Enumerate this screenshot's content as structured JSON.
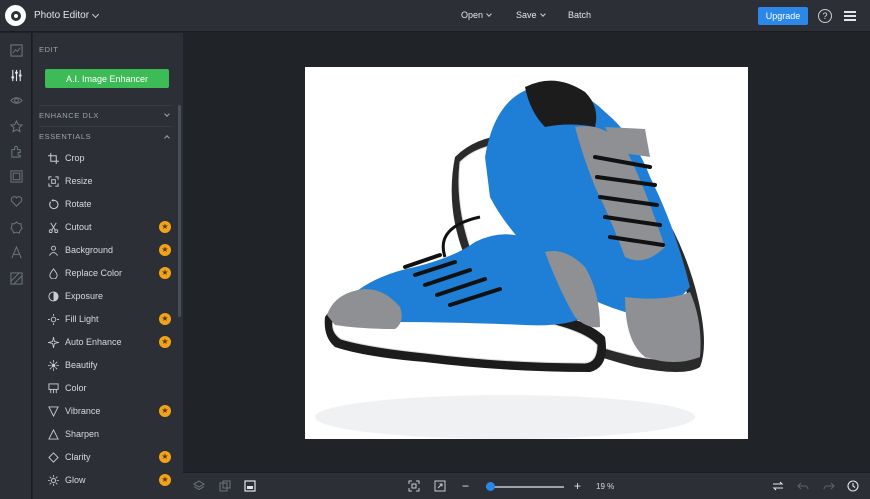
{
  "header": {
    "app_title": "Photo Editor",
    "menu": [
      {
        "label": "Open",
        "has_dropdown": true
      },
      {
        "label": "Save",
        "has_dropdown": true
      },
      {
        "label": "Batch",
        "has_dropdown": false
      }
    ],
    "upgrade_label": "Upgrade",
    "help_label": "?"
  },
  "rail": {
    "icons": [
      "image-icon",
      "sliders-icon",
      "eye-icon",
      "star-icon",
      "puzzle-icon",
      "frame-icon",
      "heart-icon",
      "badge-icon",
      "text-icon",
      "texture-icon"
    ],
    "active": "sliders-icon"
  },
  "panel": {
    "title": "EDIT",
    "ai_button": "A.I. Image Enhancer",
    "sections": [
      {
        "label": "ENHANCE DLX",
        "expanded": false
      },
      {
        "label": "ESSENTIALS",
        "expanded": true
      }
    ],
    "tools": [
      {
        "label": "Crop",
        "icon": "crop-icon",
        "premium": false
      },
      {
        "label": "Resize",
        "icon": "resize-icon",
        "premium": false
      },
      {
        "label": "Rotate",
        "icon": "rotate-icon",
        "premium": false
      },
      {
        "label": "Cutout",
        "icon": "scissors-icon",
        "premium": true
      },
      {
        "label": "Background",
        "icon": "background-icon",
        "premium": true
      },
      {
        "label": "Replace Color",
        "icon": "droplet-icon",
        "premium": true
      },
      {
        "label": "Exposure",
        "icon": "exposure-icon",
        "premium": false
      },
      {
        "label": "Fill Light",
        "icon": "fill-light-icon",
        "premium": true
      },
      {
        "label": "Auto Enhance",
        "icon": "sparkle-icon",
        "premium": true
      },
      {
        "label": "Beautify",
        "icon": "beautify-icon",
        "premium": false
      },
      {
        "label": "Color",
        "icon": "color-icon",
        "premium": false
      },
      {
        "label": "Vibrance",
        "icon": "vibrance-icon",
        "premium": true
      },
      {
        "label": "Sharpen",
        "icon": "sharpen-icon",
        "premium": false
      },
      {
        "label": "Clarity",
        "icon": "clarity-icon",
        "premium": true
      },
      {
        "label": "Glow",
        "icon": "glow-icon",
        "premium": true
      }
    ]
  },
  "bottombar": {
    "zoom_level": 19,
    "zoom_text": "19 %",
    "zoom_fraction": 0.06
  },
  "colors": {
    "accent": "#2b87e8",
    "ai_green": "#3dbb57",
    "premium_star": "#f2a31a",
    "shoe_blue": "#1f7fd6"
  }
}
